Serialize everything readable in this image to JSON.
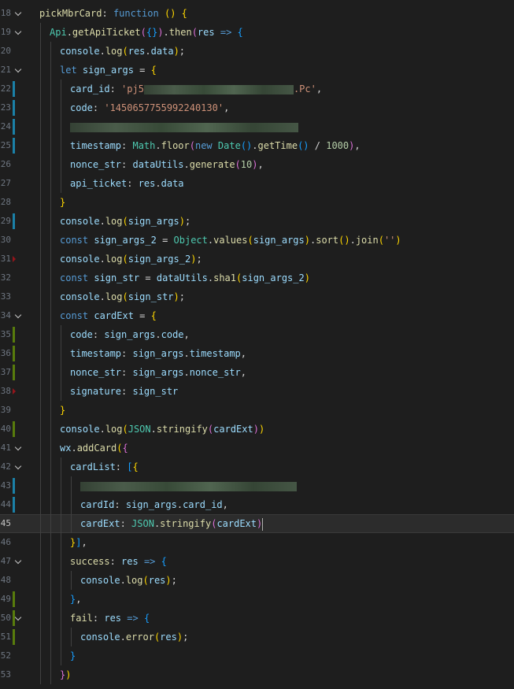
{
  "editor": {
    "current_line": "45",
    "lines": [
      {
        "n": "18",
        "fold": true,
        "mark": "",
        "indent": 0,
        "toks": [
          [
            "fnkey",
            "pickMbrCard"
          ],
          [
            "pun",
            ": "
          ],
          [
            "kw",
            "function"
          ],
          [
            "pun",
            " "
          ],
          [
            "br1",
            "()"
          ],
          [
            "pun",
            " "
          ],
          [
            "br1",
            "{"
          ]
        ]
      },
      {
        "n": "19",
        "fold": true,
        "mark": "",
        "indent": 1,
        "toks": [
          [
            "obj",
            "Api"
          ],
          [
            "pun",
            "."
          ],
          [
            "fn",
            "getApiTicket"
          ],
          [
            "br2",
            "("
          ],
          [
            "br3",
            "{}"
          ],
          [
            "br2",
            ")"
          ],
          [
            "pun",
            "."
          ],
          [
            "fn",
            "then"
          ],
          [
            "br2",
            "("
          ],
          [
            "prop",
            "res"
          ],
          [
            "pun",
            " "
          ],
          [
            "kw",
            "=>"
          ],
          [
            "pun",
            " "
          ],
          [
            "br3",
            "{"
          ]
        ]
      },
      {
        "n": "20",
        "fold": false,
        "mark": "",
        "indent": 2,
        "toks": [
          [
            "prop",
            "console"
          ],
          [
            "pun",
            "."
          ],
          [
            "fn",
            "log"
          ],
          [
            "br1",
            "("
          ],
          [
            "prop",
            "res"
          ],
          [
            "pun",
            "."
          ],
          [
            "prop",
            "data"
          ],
          [
            "br1",
            ")"
          ],
          [
            "pun",
            ";"
          ]
        ]
      },
      {
        "n": "21",
        "fold": true,
        "mark": "",
        "indent": 2,
        "toks": [
          [
            "kw",
            "let"
          ],
          [
            "pun",
            " "
          ],
          [
            "prop",
            "sign_args"
          ],
          [
            "pun",
            " = "
          ],
          [
            "br1",
            "{"
          ]
        ]
      },
      {
        "n": "22",
        "fold": false,
        "mark": "mod",
        "indent": 3,
        "toks": [
          [
            "prop",
            "card_id"
          ],
          [
            "pun",
            ": "
          ],
          [
            "str",
            "'pj5"
          ],
          [
            "blur",
            "190"
          ],
          [
            "str",
            ".Pc'"
          ],
          [
            "pun",
            ","
          ]
        ]
      },
      {
        "n": "23",
        "fold": false,
        "mark": "mod",
        "indent": 3,
        "toks": [
          [
            "prop",
            "code"
          ],
          [
            "pun",
            ": "
          ],
          [
            "str",
            "'1450657755992240130'"
          ],
          [
            "pun",
            ","
          ]
        ]
      },
      {
        "n": "24",
        "fold": false,
        "mark": "mod",
        "indent": 3,
        "toks": [
          [
            "blur",
            "290"
          ]
        ]
      },
      {
        "n": "25",
        "fold": false,
        "mark": "mod",
        "indent": 3,
        "toks": [
          [
            "prop",
            "timestamp"
          ],
          [
            "pun",
            ": "
          ],
          [
            "obj",
            "Math"
          ],
          [
            "pun",
            "."
          ],
          [
            "fn",
            "floor"
          ],
          [
            "br2",
            "("
          ],
          [
            "kw",
            "new"
          ],
          [
            "pun",
            " "
          ],
          [
            "obj",
            "Date"
          ],
          [
            "br3",
            "()"
          ],
          [
            "pun",
            "."
          ],
          [
            "fn",
            "getTime"
          ],
          [
            "br3",
            "()"
          ],
          [
            "pun",
            " / "
          ],
          [
            "num",
            "1000"
          ],
          [
            "br2",
            ")"
          ],
          [
            "pun",
            ","
          ]
        ]
      },
      {
        "n": "26",
        "fold": false,
        "mark": "",
        "indent": 3,
        "toks": [
          [
            "prop",
            "nonce_str"
          ],
          [
            "pun",
            ": "
          ],
          [
            "prop",
            "dataUtils"
          ],
          [
            "pun",
            "."
          ],
          [
            "fn",
            "generate"
          ],
          [
            "br2",
            "("
          ],
          [
            "num",
            "10"
          ],
          [
            "br2",
            ")"
          ],
          [
            "pun",
            ","
          ]
        ]
      },
      {
        "n": "27",
        "fold": false,
        "mark": "",
        "indent": 3,
        "toks": [
          [
            "prop",
            "api_ticket"
          ],
          [
            "pun",
            ": "
          ],
          [
            "prop",
            "res"
          ],
          [
            "pun",
            "."
          ],
          [
            "prop",
            "data"
          ]
        ]
      },
      {
        "n": "28",
        "fold": false,
        "mark": "",
        "indent": 2,
        "toks": [
          [
            "br1",
            "}"
          ]
        ]
      },
      {
        "n": "29",
        "fold": false,
        "mark": "mod",
        "indent": 2,
        "toks": [
          [
            "prop",
            "console"
          ],
          [
            "pun",
            "."
          ],
          [
            "fn",
            "log"
          ],
          [
            "br1",
            "("
          ],
          [
            "prop",
            "sign_args"
          ],
          [
            "br1",
            ")"
          ],
          [
            "pun",
            ";"
          ]
        ]
      },
      {
        "n": "30",
        "fold": false,
        "mark": "",
        "indent": 2,
        "toks": [
          [
            "kw",
            "const"
          ],
          [
            "pun",
            " "
          ],
          [
            "prop",
            "sign_args_2"
          ],
          [
            "pun",
            " = "
          ],
          [
            "obj",
            "Object"
          ],
          [
            "pun",
            "."
          ],
          [
            "fn",
            "values"
          ],
          [
            "br1",
            "("
          ],
          [
            "prop",
            "sign_args"
          ],
          [
            "br1",
            ")"
          ],
          [
            "pun",
            "."
          ],
          [
            "fn",
            "sort"
          ],
          [
            "br1",
            "()"
          ],
          [
            "pun",
            "."
          ],
          [
            "fn",
            "join"
          ],
          [
            "br1",
            "("
          ],
          [
            "str",
            "''"
          ],
          [
            "br1",
            ")"
          ]
        ]
      },
      {
        "n": "31",
        "fold": false,
        "mark": "del",
        "indent": 2,
        "toks": [
          [
            "prop",
            "console"
          ],
          [
            "pun",
            "."
          ],
          [
            "fn",
            "log"
          ],
          [
            "br1",
            "("
          ],
          [
            "prop",
            "sign_args_2"
          ],
          [
            "br1",
            ")"
          ],
          [
            "pun",
            ";"
          ]
        ]
      },
      {
        "n": "32",
        "fold": false,
        "mark": "",
        "indent": 2,
        "toks": [
          [
            "kw",
            "const"
          ],
          [
            "pun",
            " "
          ],
          [
            "prop",
            "sign_str"
          ],
          [
            "pun",
            " = "
          ],
          [
            "prop",
            "dataUtils"
          ],
          [
            "pun",
            "."
          ],
          [
            "fn",
            "sha1"
          ],
          [
            "br1",
            "("
          ],
          [
            "prop",
            "sign_args_2"
          ],
          [
            "br1",
            ")"
          ]
        ]
      },
      {
        "n": "33",
        "fold": false,
        "mark": "",
        "indent": 2,
        "toks": [
          [
            "prop",
            "console"
          ],
          [
            "pun",
            "."
          ],
          [
            "fn",
            "log"
          ],
          [
            "br1",
            "("
          ],
          [
            "prop",
            "sign_str"
          ],
          [
            "br1",
            ")"
          ],
          [
            "pun",
            ";"
          ]
        ]
      },
      {
        "n": "34",
        "fold": true,
        "mark": "",
        "indent": 2,
        "toks": [
          [
            "kw",
            "const"
          ],
          [
            "pun",
            " "
          ],
          [
            "prop",
            "cardExt"
          ],
          [
            "pun",
            " = "
          ],
          [
            "br1",
            "{"
          ]
        ]
      },
      {
        "n": "35",
        "fold": false,
        "mark": "add",
        "indent": 3,
        "toks": [
          [
            "prop",
            "code"
          ],
          [
            "pun",
            ": "
          ],
          [
            "prop",
            "sign_args"
          ],
          [
            "pun",
            "."
          ],
          [
            "prop",
            "code"
          ],
          [
            "pun",
            ","
          ]
        ]
      },
      {
        "n": "36",
        "fold": false,
        "mark": "add",
        "indent": 3,
        "toks": [
          [
            "prop",
            "timestamp"
          ],
          [
            "pun",
            ": "
          ],
          [
            "prop",
            "sign_args"
          ],
          [
            "pun",
            "."
          ],
          [
            "prop",
            "timestamp"
          ],
          [
            "pun",
            ","
          ]
        ]
      },
      {
        "n": "37",
        "fold": false,
        "mark": "add",
        "indent": 3,
        "toks": [
          [
            "prop",
            "nonce_str"
          ],
          [
            "pun",
            ": "
          ],
          [
            "prop",
            "sign_args"
          ],
          [
            "pun",
            "."
          ],
          [
            "prop",
            "nonce_str"
          ],
          [
            "pun",
            ","
          ]
        ]
      },
      {
        "n": "38",
        "fold": false,
        "mark": "del",
        "indent": 3,
        "toks": [
          [
            "prop",
            "signature"
          ],
          [
            "pun",
            ": "
          ],
          [
            "prop",
            "sign_str"
          ]
        ]
      },
      {
        "n": "39",
        "fold": false,
        "mark": "",
        "indent": 2,
        "toks": [
          [
            "br1",
            "}"
          ]
        ]
      },
      {
        "n": "40",
        "fold": false,
        "mark": "add",
        "indent": 2,
        "toks": [
          [
            "prop",
            "console"
          ],
          [
            "pun",
            "."
          ],
          [
            "fn",
            "log"
          ],
          [
            "br1",
            "("
          ],
          [
            "obj",
            "JSON"
          ],
          [
            "pun",
            "."
          ],
          [
            "fn",
            "stringify"
          ],
          [
            "br2",
            "("
          ],
          [
            "prop",
            "cardExt"
          ],
          [
            "br2",
            ")"
          ],
          [
            "br1",
            ")"
          ]
        ]
      },
      {
        "n": "41",
        "fold": true,
        "mark": "",
        "indent": 2,
        "toks": [
          [
            "prop",
            "wx"
          ],
          [
            "pun",
            "."
          ],
          [
            "fn",
            "addCard"
          ],
          [
            "br1",
            "("
          ],
          [
            "br2",
            "{"
          ]
        ]
      },
      {
        "n": "42",
        "fold": true,
        "mark": "",
        "indent": 3,
        "toks": [
          [
            "prop",
            "cardList"
          ],
          [
            "pun",
            ": "
          ],
          [
            "br3",
            "["
          ],
          [
            "br1",
            "{"
          ]
        ]
      },
      {
        "n": "43",
        "fold": false,
        "mark": "mod",
        "indent": 4,
        "toks": [
          [
            "blur",
            "275"
          ]
        ]
      },
      {
        "n": "44",
        "fold": false,
        "mark": "mod",
        "indent": 4,
        "toks": [
          [
            "prop",
            "cardId"
          ],
          [
            "pun",
            ": "
          ],
          [
            "prop",
            "sign_args"
          ],
          [
            "pun",
            "."
          ],
          [
            "prop",
            "card_id"
          ],
          [
            "pun",
            ","
          ]
        ]
      },
      {
        "n": "45",
        "fold": false,
        "mark": "",
        "indent": 4,
        "toks": [
          [
            "prop",
            "cardExt"
          ],
          [
            "pun",
            ": "
          ],
          [
            "obj",
            "JSON"
          ],
          [
            "pun",
            "."
          ],
          [
            "fn",
            "stringify"
          ],
          [
            "br2",
            "("
          ],
          [
            "prop",
            "cardExt"
          ],
          [
            "br2",
            ")"
          ]
        ]
      },
      {
        "n": "46",
        "fold": false,
        "mark": "",
        "indent": 3,
        "toks": [
          [
            "br1",
            "}"
          ],
          [
            "br3",
            "]"
          ],
          [
            "pun",
            ","
          ]
        ]
      },
      {
        "n": "47",
        "fold": true,
        "mark": "",
        "indent": 3,
        "toks": [
          [
            "fnkey",
            "success"
          ],
          [
            "pun",
            ": "
          ],
          [
            "prop",
            "res"
          ],
          [
            "pun",
            " "
          ],
          [
            "kw",
            "=>"
          ],
          [
            "pun",
            " "
          ],
          [
            "br3",
            "{"
          ]
        ]
      },
      {
        "n": "48",
        "fold": false,
        "mark": "",
        "indent": 4,
        "toks": [
          [
            "prop",
            "console"
          ],
          [
            "pun",
            "."
          ],
          [
            "fn",
            "log"
          ],
          [
            "br1",
            "("
          ],
          [
            "prop",
            "res"
          ],
          [
            "br1",
            ")"
          ],
          [
            "pun",
            ";"
          ]
        ]
      },
      {
        "n": "49",
        "fold": false,
        "mark": "add",
        "indent": 3,
        "toks": [
          [
            "br3",
            "}"
          ],
          [
            "pun",
            ","
          ]
        ]
      },
      {
        "n": "50",
        "fold": true,
        "mark": "add",
        "indent": 3,
        "toks": [
          [
            "fnkey",
            "fail"
          ],
          [
            "pun",
            ": "
          ],
          [
            "prop",
            "res"
          ],
          [
            "pun",
            " "
          ],
          [
            "kw",
            "=>"
          ],
          [
            "pun",
            " "
          ],
          [
            "br3",
            "{"
          ]
        ]
      },
      {
        "n": "51",
        "fold": false,
        "mark": "add",
        "indent": 4,
        "toks": [
          [
            "prop",
            "console"
          ],
          [
            "pun",
            "."
          ],
          [
            "fn",
            "error"
          ],
          [
            "br1",
            "("
          ],
          [
            "prop",
            "res"
          ],
          [
            "br1",
            ")"
          ],
          [
            "pun",
            ";"
          ]
        ]
      },
      {
        "n": "52",
        "fold": false,
        "mark": "",
        "indent": 3,
        "toks": [
          [
            "br3",
            "}"
          ]
        ]
      },
      {
        "n": "53",
        "fold": false,
        "mark": "",
        "indent": 2,
        "toks": [
          [
            "br2",
            "}"
          ],
          [
            "br1",
            ")"
          ]
        ]
      }
    ]
  }
}
